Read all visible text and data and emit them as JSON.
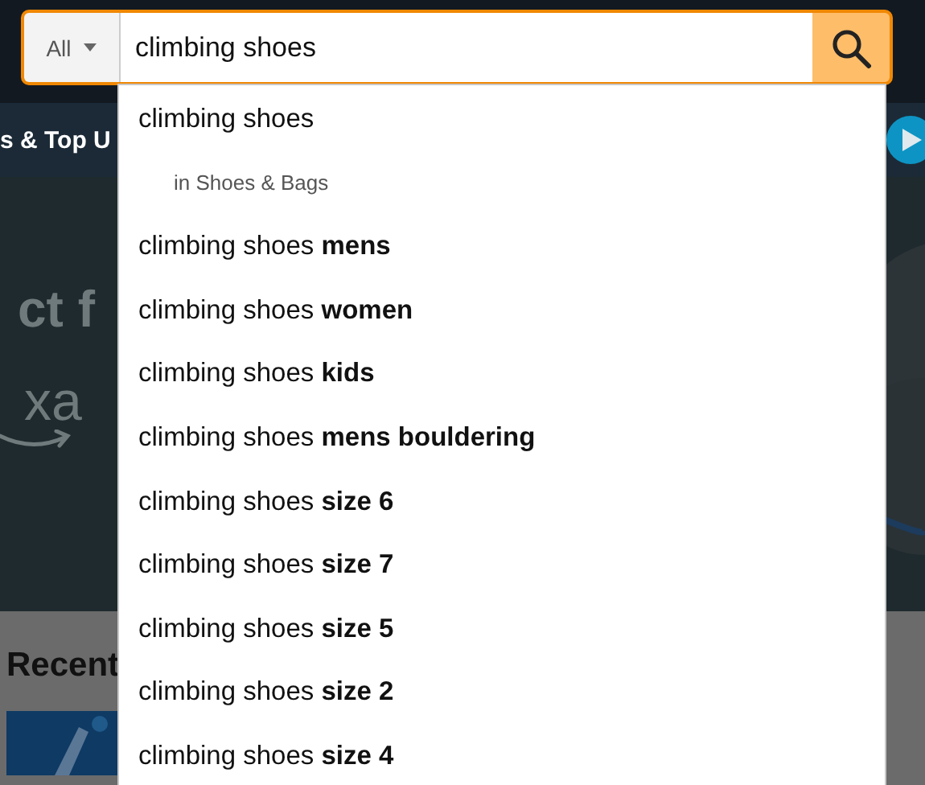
{
  "search": {
    "category": "All",
    "value": "climbing shoes"
  },
  "nav": {
    "text": "s & Top U"
  },
  "hero": {
    "headline": "ct f",
    "brand": "xa"
  },
  "section": {
    "title": "Recent"
  },
  "suggestions": [
    {
      "kind": "query",
      "text": "climbing shoes"
    },
    {
      "kind": "department",
      "prefix": "in",
      "department": "Shoes & Bags"
    },
    {
      "kind": "query",
      "text": "climbing shoes **mens**"
    },
    {
      "kind": "query",
      "text": "climbing shoes **women**"
    },
    {
      "kind": "query",
      "text": "climbing shoes **kids**"
    },
    {
      "kind": "query",
      "text": "climbing shoes **mens bouldering**"
    },
    {
      "kind": "query",
      "text": "climbing shoes **size 6**"
    },
    {
      "kind": "query",
      "text": "climbing shoes **size 7**"
    },
    {
      "kind": "query",
      "text": "climbing shoes **size 5**"
    },
    {
      "kind": "query",
      "text": "climbing shoes **size 2**"
    },
    {
      "kind": "query",
      "text": "climbing shoes **size 4**"
    }
  ]
}
